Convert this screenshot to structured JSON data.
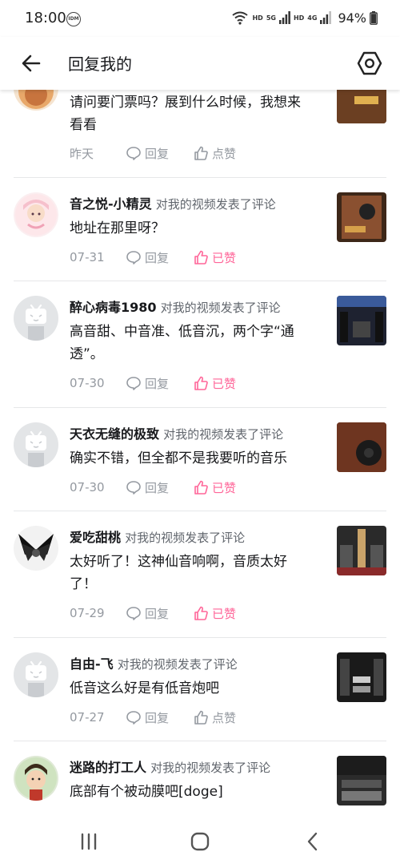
{
  "status_bar": {
    "time": "18:00",
    "idm_label": "IDM",
    "hd1": "HD",
    "net1": "5G",
    "hd2": "HD",
    "net2": "4G",
    "battery": "94%"
  },
  "app_bar": {
    "title": "回复我的",
    "back_icon": "arrow-left-icon",
    "settings_icon": "hexagon-settings-icon"
  },
  "action_text": "对我的视频发表了评论",
  "reply_label": "回复",
  "colors": {
    "liked": "#ff6699",
    "meta": "#9499a0",
    "divider": "#e6e7e9"
  },
  "items": [
    {
      "user": "",
      "comment_lines": [
        "请问要门票吗？展到什么时候，我想来",
        "看看"
      ],
      "date": "昨天",
      "like_label": "点赞",
      "liked": false
    },
    {
      "user": "音之悦-小精灵",
      "comment_lines": [
        "地址在那里呀？"
      ],
      "date": "07-31",
      "like_label": "已赞",
      "liked": true
    },
    {
      "user": "醉心病毒1980",
      "comment_lines": [
        "高音甜、中音准、低音沉，两个字“通",
        "透”。"
      ],
      "date": "07-30",
      "like_label": "已赞",
      "liked": true
    },
    {
      "user": "天衣无缝的极致",
      "comment_lines": [
        "确实不错，但全都不是我要听的音乐"
      ],
      "date": "07-30",
      "like_label": "已赞",
      "liked": true
    },
    {
      "user": "爱吃甜桃",
      "comment_lines": [
        "太好听了！这神仙音响啊，音质太好",
        "了！"
      ],
      "date": "07-29",
      "like_label": "已赞",
      "liked": true
    },
    {
      "user": "自由-飞",
      "comment_lines": [
        "低音这么好是有低音炮吧"
      ],
      "date": "07-27",
      "like_label": "点赞",
      "liked": false
    },
    {
      "user": "迷路的打工人",
      "comment_lines": [
        "底部有个被动膜吧[doge]"
      ],
      "date": "",
      "like_label": "",
      "liked": false
    }
  ],
  "nav_bar": {
    "recents_icon": "recents-icon",
    "home_icon": "home-icon",
    "back_icon": "back-chevron-icon"
  }
}
